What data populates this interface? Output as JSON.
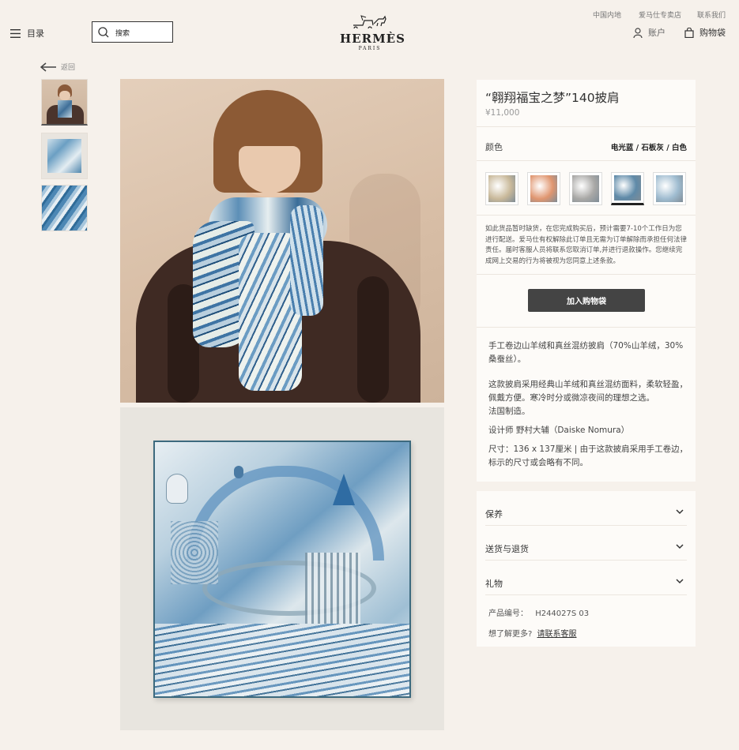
{
  "topbar": {
    "region": "中国内地",
    "stores": "爱马仕专卖店",
    "contact": "联系我们"
  },
  "header": {
    "menu_label": "目录",
    "search_placeholder": "搜索",
    "logo_main": "HERMÈS",
    "logo_sub": "PARIS",
    "account_label": "账户",
    "bag_label": "购物袋"
  },
  "back": {
    "label": "返回"
  },
  "product": {
    "title": "“翱翔福宝之梦”140披肩",
    "price": "¥11,000",
    "color_label": "颜色",
    "color_value": "电光蓝 / 石板灰 / 白色",
    "notice": "如此货品暂时缺货，在您完成购买后，预计需要7-10个工作日为您进行配送。爱马仕有权解除此订单且无需为订单解除而承担任何法律责任。届时客服人员将联系您取消订单,并进行退款操作。您继续完成网上交易的行为将被视为您同意上述条款。",
    "add_to_bag": "加入购物袋",
    "desc_1": "手工卷边山羊绒和真丝混纺披肩（70%山羊绒，30%桑蚕丝）。",
    "desc_2": "这款披肩采用经典山羊绒和真丝混纺面料，柔软轻盈，佩戴方便。寒冷时分或微凉夜间的理想之选。",
    "desc_3": "法国制造。",
    "desc_4": "设计师 野村大辅（Daiske Nomura）",
    "desc_5": "尺寸：136 x 137厘米 | 由于这款披肩采用手工卷边，标示的尺寸或会略有不同。"
  },
  "swatches": [
    {
      "name": "swatch-1",
      "color": "#c9b99a"
    },
    {
      "name": "swatch-2",
      "color": "#e09670"
    },
    {
      "name": "swatch-3",
      "color": "#a9a8a6"
    },
    {
      "name": "swatch-4",
      "color": "#5f8aa8"
    },
    {
      "name": "swatch-5",
      "color": "#9fbcd0"
    }
  ],
  "accordion": {
    "care": "保养",
    "shipping": "送货与退货",
    "gift": "礼物"
  },
  "meta": {
    "product_code_label": "产品编号：",
    "product_code": "H244027S 03",
    "more_label": "想了解更多?",
    "contact_link": "请联系客服"
  }
}
